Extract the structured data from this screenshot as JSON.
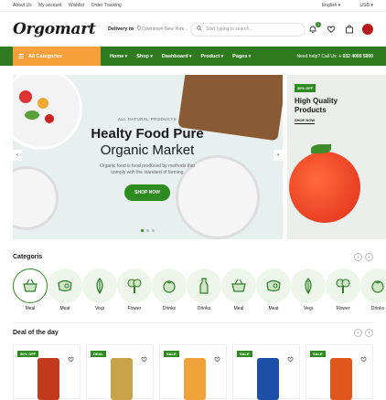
{
  "topbar": {
    "links": [
      "About Us",
      "My account",
      "Wishlist",
      "Order Tracking"
    ],
    "language": "English",
    "currency": "USD"
  },
  "header": {
    "logo": "Orgomart",
    "delivery_label": "Delivery to",
    "delivery_location": "Downtown New York...",
    "search_placeholder": "Start typing to search...",
    "notifications_count": "3"
  },
  "nav": {
    "all_categories": "All Categories",
    "items": [
      "Home",
      "Shop",
      "Dashboard",
      "Product",
      "Pages"
    ],
    "help_label": "Need help? Call Us:",
    "help_phone": "+ 032 4000 5000"
  },
  "hero": {
    "pretitle": "ALL NATURAL PRODUCTS",
    "title_line1": "Healty Food Pure",
    "title_line2": "Organic Market",
    "description": "Organic food is food produced by methods that comply with the standard of farming",
    "button": "SHOP NOW",
    "prev": "‹",
    "next": "›"
  },
  "promo": {
    "tag": "30% OFF",
    "title_line1": "High Quality",
    "title_line2": "Products",
    "button": "SHOP NOW"
  },
  "categories": {
    "title": "Categoris",
    "items": [
      {
        "label": "Meal",
        "icon": "basket-icon"
      },
      {
        "label": "Meat",
        "icon": "meat-icon"
      },
      {
        "label": "Vegi",
        "icon": "leaf-icon"
      },
      {
        "label": "Flower",
        "icon": "broccoli-icon"
      },
      {
        "label": "Drinks",
        "icon": "tomato-icon"
      },
      {
        "label": "Drinks",
        "icon": "bottle-icon"
      },
      {
        "label": "Meal",
        "icon": "basket-icon"
      },
      {
        "label": "Meat",
        "icon": "meat-icon"
      },
      {
        "label": "Vegi",
        "icon": "leaf-icon"
      },
      {
        "label": "Flower",
        "icon": "broccoli-icon"
      },
      {
        "label": "Drinks",
        "icon": "tomato-icon"
      }
    ]
  },
  "deals": {
    "title": "Deal of the day",
    "items": [
      {
        "tag": "30% OFF",
        "color": "#c23a1b"
      },
      {
        "tag": "DEAL",
        "color": "#c9a24a"
      },
      {
        "tag": "SALE",
        "color": "#f0a33a"
      },
      {
        "tag": "SALE",
        "color": "#1d4fa8"
      },
      {
        "tag": "SALE",
        "color": "#e0561c"
      }
    ]
  },
  "colors": {
    "primary": "#2e8b20",
    "accent": "#f5a03a",
    "nav": "#2f7a1f"
  }
}
